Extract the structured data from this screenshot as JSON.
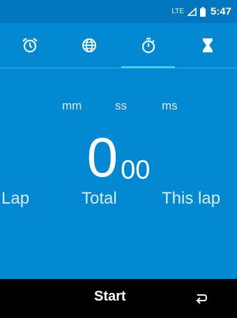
{
  "status": {
    "network": "LTE",
    "time": "5:47"
  },
  "tabs": [
    {
      "name": "alarm-icon",
      "selected": false
    },
    {
      "name": "globe-icon",
      "selected": false
    },
    {
      "name": "stopwatch-icon",
      "selected": true
    },
    {
      "name": "hourglass-icon",
      "selected": false
    }
  ],
  "stopwatch": {
    "units": {
      "mm": "mm",
      "ss": "ss",
      "ms": "ms"
    },
    "minutes": "0",
    "seconds": "00",
    "columns": {
      "lap": "Lap",
      "total": "Total",
      "this_lap": "This lap"
    }
  },
  "bottom": {
    "start_label": "Start",
    "back_icon": "back-arrow-icon"
  },
  "colors": {
    "background": "#0288d1",
    "statusbar": "#0277bd",
    "indicator": "#4dd0e1"
  }
}
